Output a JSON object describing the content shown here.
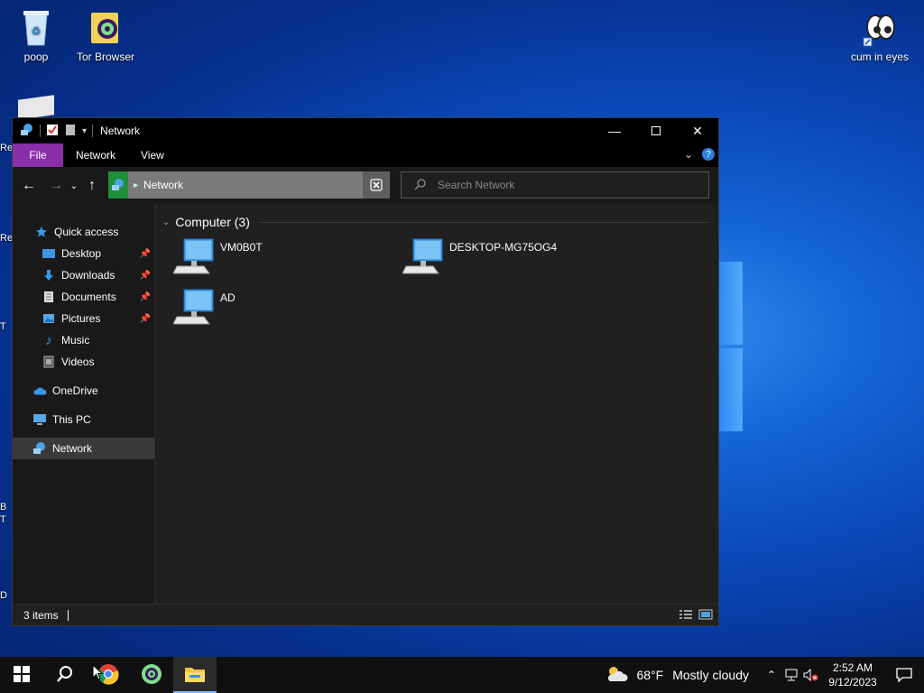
{
  "desktop": {
    "icons": [
      {
        "label": "poop"
      },
      {
        "label": "Tor Browser"
      },
      {
        "label": "cum in eyes"
      }
    ],
    "edge_labels": [
      "Re",
      "Re",
      "T",
      "B",
      "T",
      "D"
    ]
  },
  "explorer": {
    "title": "Network",
    "ribbon_tabs": [
      "File",
      "Network",
      "View"
    ],
    "address": "Network",
    "search_placeholder": "Search Network",
    "nav": {
      "quick_access": "Quick access",
      "items": [
        "Desktop",
        "Downloads",
        "Documents",
        "Pictures",
        "Music",
        "Videos"
      ],
      "onedrive": "OneDrive",
      "thispc": "This PC",
      "network": "Network"
    },
    "group_label": "Computer (3)",
    "computers": [
      "VM0B0T",
      "DESKTOP-MG75OG4",
      "AD"
    ],
    "status": "3 items"
  },
  "taskbar": {
    "weather_temp": "68°F",
    "weather_desc": "Mostly cloudy",
    "time": "2:52 AM",
    "date": "9/12/2023"
  },
  "colors": {
    "file_tab": "#8a2fa8",
    "address_bg": "#7a7a7a",
    "accent": "#7cb7ff"
  }
}
